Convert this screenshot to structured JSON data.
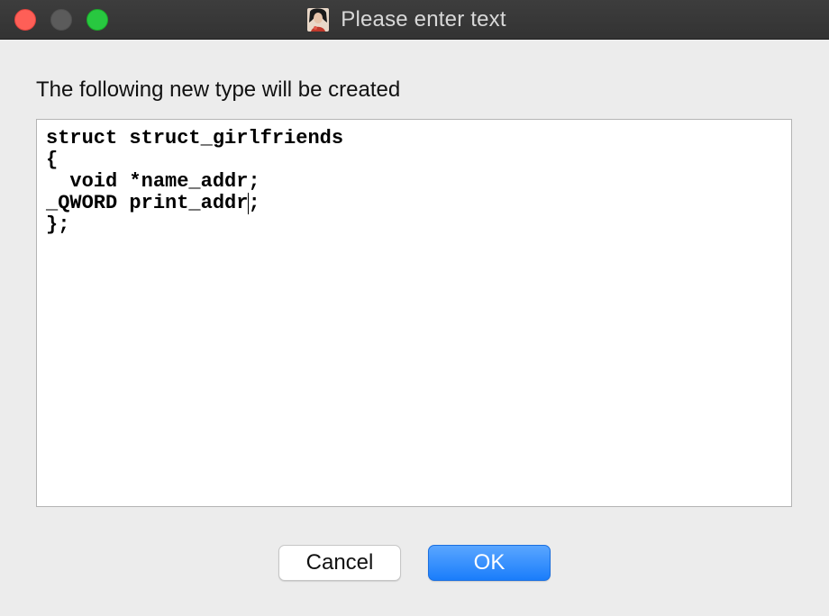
{
  "window": {
    "title": "Please enter text",
    "controls": [
      "close",
      "minimize",
      "zoom"
    ],
    "app_icon": "portrait-icon"
  },
  "dialog": {
    "prompt": "The following new type will be created",
    "text_lines": [
      "struct struct_girlfriends",
      "{",
      "  void *name_addr;",
      "  _QWORD print_addr",
      "};"
    ],
    "caret_after": "_QWORD print_addr",
    "caret_tail": ";"
  },
  "buttons": {
    "cancel_label": "Cancel",
    "ok_label": "OK"
  },
  "colors": {
    "close": "#fe5f57",
    "minimize": "#5b5b5b",
    "zoom": "#28c840",
    "accent": "#1a7dfb"
  }
}
